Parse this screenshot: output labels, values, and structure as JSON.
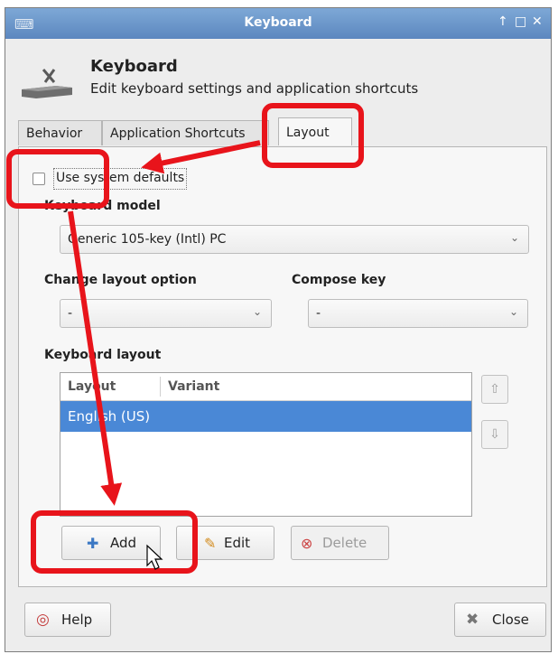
{
  "window": {
    "title": "Keyboard",
    "controls": {
      "up": "↑",
      "maximize": "□",
      "close": "✕"
    }
  },
  "header": {
    "title": "Keyboard",
    "subtitle": "Edit keyboard settings and application shortcuts",
    "icon": "keyboard-icon"
  },
  "tabs": [
    {
      "label": "Behavior",
      "active": false
    },
    {
      "label": "Application Shortcuts",
      "active": false
    },
    {
      "label": "Layout",
      "active": true
    }
  ],
  "layout_tab": {
    "use_system_defaults": {
      "label": "Use system defaults",
      "checked": false
    },
    "keyboard_model": {
      "label": "Keyboard model",
      "value": "Generic 105-key (Intl) PC"
    },
    "change_layout_option": {
      "label": "Change layout option",
      "value": "-"
    },
    "compose_key": {
      "label": "Compose key",
      "value": "-"
    },
    "keyboard_layout": {
      "label": "Keyboard layout",
      "columns": [
        "Layout",
        "Variant"
      ],
      "rows": [
        {
          "layout": "English (US)",
          "variant": "",
          "selected": true
        }
      ]
    },
    "buttons": {
      "add": "Add",
      "edit": "Edit",
      "delete": "Delete"
    }
  },
  "footer": {
    "help": "Help",
    "close": "Close"
  },
  "colors": {
    "titlebar": "#5c87bf",
    "selection": "#4a88d6",
    "annotation": "#e8141b"
  }
}
